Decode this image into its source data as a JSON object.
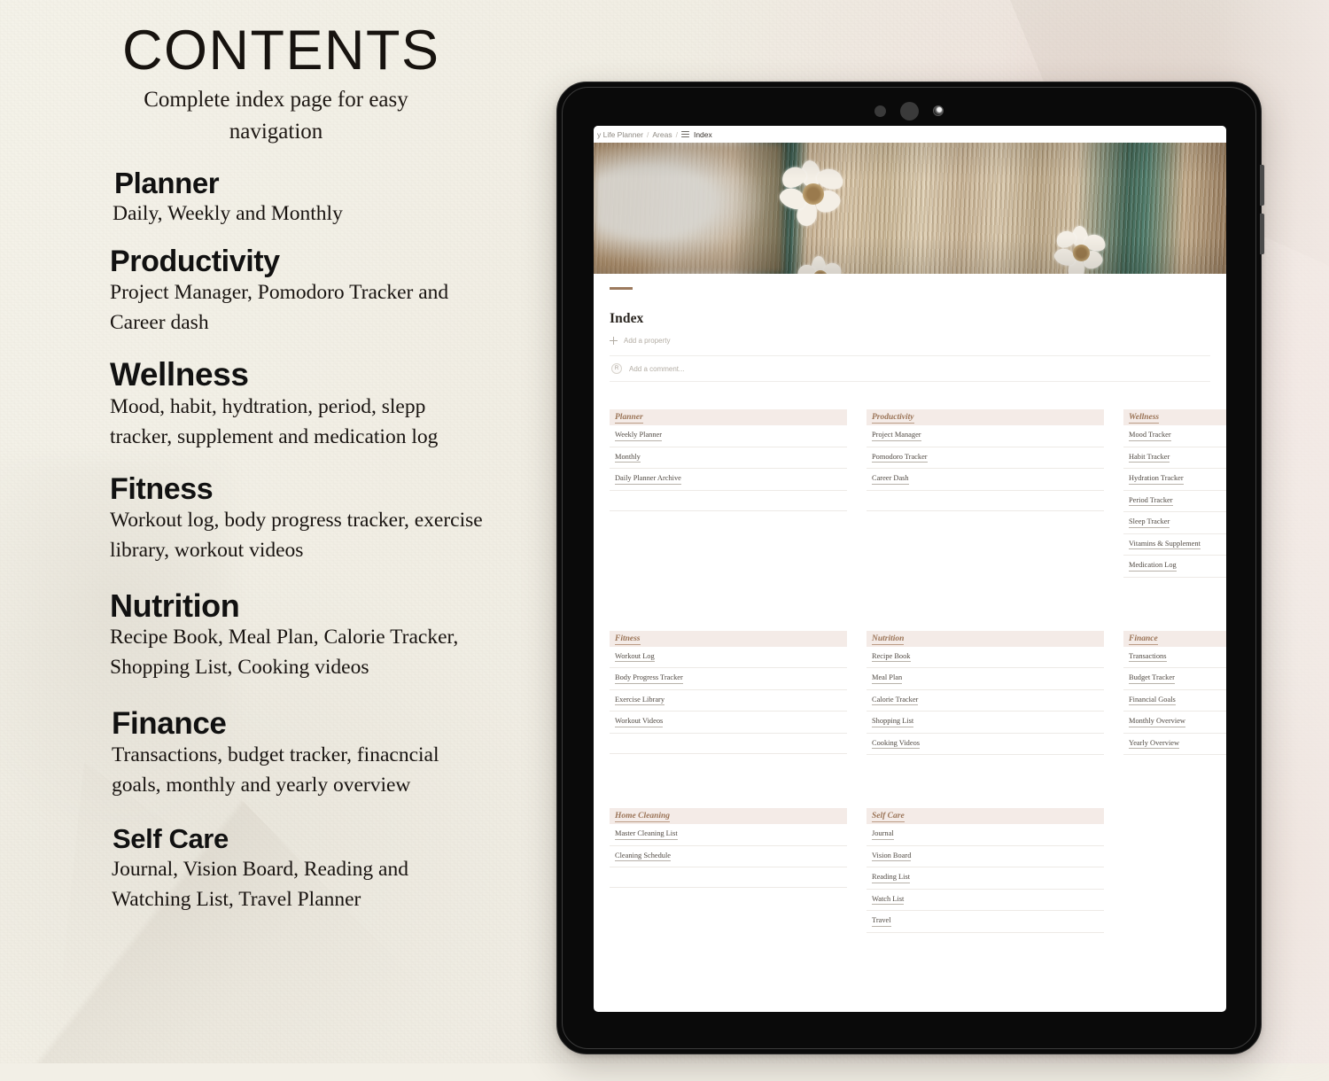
{
  "left_panel": {
    "title": "CONTENTS",
    "subtitle": "Complete index page for easy navigation",
    "sections": [
      {
        "heading": "Planner",
        "description": "Daily, Weekly and Monthly"
      },
      {
        "heading": "Productivity",
        "description": "Project Manager, Pomodoro Tracker and Career dash"
      },
      {
        "heading": "Wellness",
        "description": "Mood, habit, hydtration, period, slepp tracker, supplement and medication log"
      },
      {
        "heading": "Fitness",
        "description": "Workout log, body progress tracker, exercise library, workout videos"
      },
      {
        "heading": "Nutrition",
        "description": "Recipe Book, Meal Plan, Calorie Tracker, Shopping List, Cooking videos"
      },
      {
        "heading": "Finance",
        "description": "Transactions, budget tracker, finacncial goals, monthly and yearly overview"
      },
      {
        "heading": "Self Care",
        "description": "Journal, Vision Board, Reading and Watching List, Travel Planner"
      }
    ]
  },
  "tablet": {
    "breadcrumb": {
      "workspace": "y Life Planner",
      "sep1": "/",
      "parent": "Areas",
      "sep2": "/",
      "current": "Index"
    },
    "page": {
      "title": "Index",
      "add_property_label": "Add a property",
      "comment_avatar_initial": "R",
      "comment_placeholder": "Add a comment..."
    },
    "columns": [
      {
        "title": "Planner",
        "items": [
          "Weekly Planner",
          "Monthly",
          "Daily Planner Archive"
        ]
      },
      {
        "title": "Productivity",
        "items": [
          "Project Manager",
          "Pomodoro Tracker",
          "Career Dash"
        ]
      },
      {
        "title": "Wellness",
        "items": [
          "Mood Tracker",
          "Habit Tracker",
          "Hydration Tracker",
          "Period Tracker",
          "Sleep Tracker",
          "Vitamins & Supplement",
          "Medication Log"
        ]
      },
      {
        "title": "Fitness",
        "items": [
          "Workout Log",
          "Body Progress Tracker",
          "Exercise Library",
          "Workout Videos"
        ]
      },
      {
        "title": "Nutrition",
        "items": [
          "Recipe Book",
          "Meal Plan",
          "Calorie Tracker",
          "Shopping List",
          "Cooking Videos"
        ]
      },
      {
        "title": "Finance",
        "items": [
          "Transactions",
          "Budget Tracker",
          "Financial Goals",
          "Monthly Overview",
          "Yearly Overview"
        ]
      },
      {
        "title": "Home Cleaning",
        "items": [
          "Master Cleaning List",
          "Cleaning Schedule"
        ]
      },
      {
        "title": "Self Care",
        "items": [
          "Journal",
          "Vision Board",
          "Reading List",
          "Watch List",
          "Travel"
        ]
      }
    ]
  },
  "colors": {
    "page_background": "#f2efe6",
    "accent_bar": "#9c7a5e",
    "card_header_bg": "#f4ebe7",
    "card_header_text": "#9b7457",
    "row_text": "#514a43",
    "device_body": "#0a0a0a"
  }
}
